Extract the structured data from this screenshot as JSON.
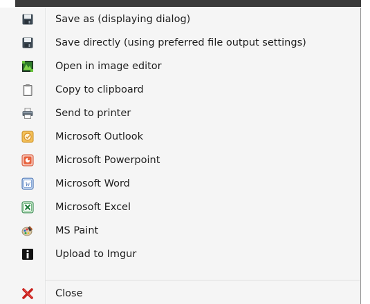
{
  "menu": {
    "items": [
      {
        "label": "Save as (displaying dialog)",
        "icon": "floppy-disk-icon"
      },
      {
        "label": "Save directly (using preferred file output settings)",
        "icon": "floppy-disk-icon"
      },
      {
        "label": "Open in image editor",
        "icon": "image-editor-icon"
      },
      {
        "label": "Copy to clipboard",
        "icon": "clipboard-icon"
      },
      {
        "label": "Send to printer",
        "icon": "printer-icon"
      },
      {
        "label": "Microsoft Outlook",
        "icon": "outlook-icon"
      },
      {
        "label": "Microsoft Powerpoint",
        "icon": "powerpoint-icon"
      },
      {
        "label": "Microsoft Word",
        "icon": "word-icon"
      },
      {
        "label": "Microsoft Excel",
        "icon": "excel-icon"
      },
      {
        "label": "MS Paint",
        "icon": "paint-icon"
      },
      {
        "label": "Upload to Imgur",
        "icon": "imgur-icon"
      }
    ],
    "close": {
      "label": "Close",
      "icon": "close-icon"
    }
  },
  "colors": {
    "menu_background": "#f5f5f5",
    "text": "#1e1e1e",
    "close_red": "#c8201c",
    "excel_green": "#1f7a3a",
    "word_blue": "#2f5ea8",
    "powerpoint_red": "#d24726",
    "outlook_orange": "#e8a23a"
  }
}
